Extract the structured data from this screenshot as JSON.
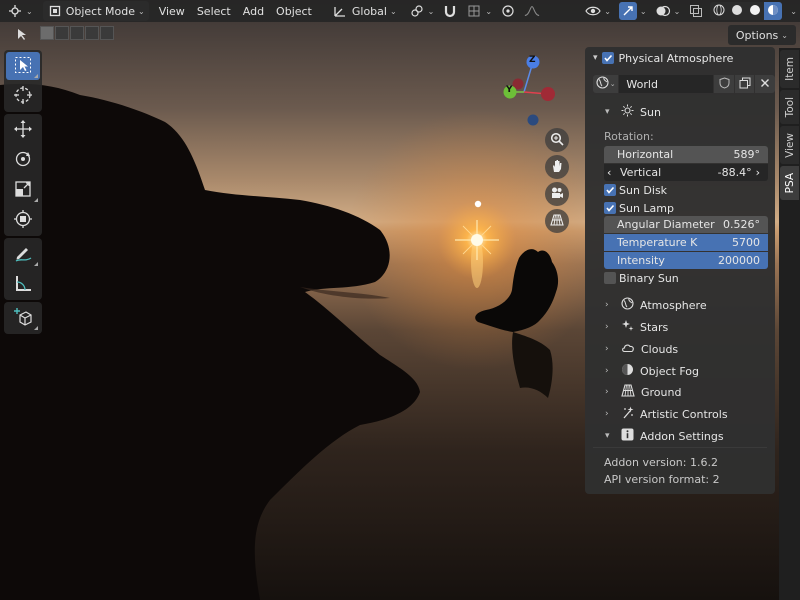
{
  "header": {
    "mode_label": "Object Mode",
    "menus": [
      "View",
      "Select",
      "Add",
      "Object"
    ],
    "orientation_label": "Global",
    "options_label": "Options"
  },
  "sidebar_tabs": [
    "Item",
    "Tool",
    "View",
    "PSA"
  ],
  "gizmo": {
    "z": "Z",
    "y": "Y"
  },
  "panel": {
    "title": "Physical Atmosphere",
    "world_name": "World",
    "sun_section": "Sun",
    "rotation_label": "Rotation:",
    "horizontal_label": "Horizontal",
    "horizontal_value": "589°",
    "vertical_label": "Vertical",
    "vertical_value": "-88.4°",
    "sun_disk_label": "Sun Disk",
    "sun_lamp_label": "Sun Lamp",
    "angular_diameter_label": "Angular Diameter",
    "angular_diameter_value": "0.526°",
    "temperature_label": "Temperature K",
    "temperature_value": "5700",
    "intensity_label": "Intensity",
    "intensity_value": "200000",
    "binary_sun_label": "Binary Sun",
    "sections": [
      "Atmosphere",
      "Stars",
      "Clouds",
      "Object Fog",
      "Ground",
      "Artistic Controls",
      "Addon Settings"
    ],
    "addon_version": "Addon version: 1.6.2",
    "api_version": "API version format: 2"
  },
  "colors": {
    "accent": "#4772b3",
    "panel_bg": "#303030",
    "field_grey": "#545454",
    "header_bg": "#262626"
  }
}
